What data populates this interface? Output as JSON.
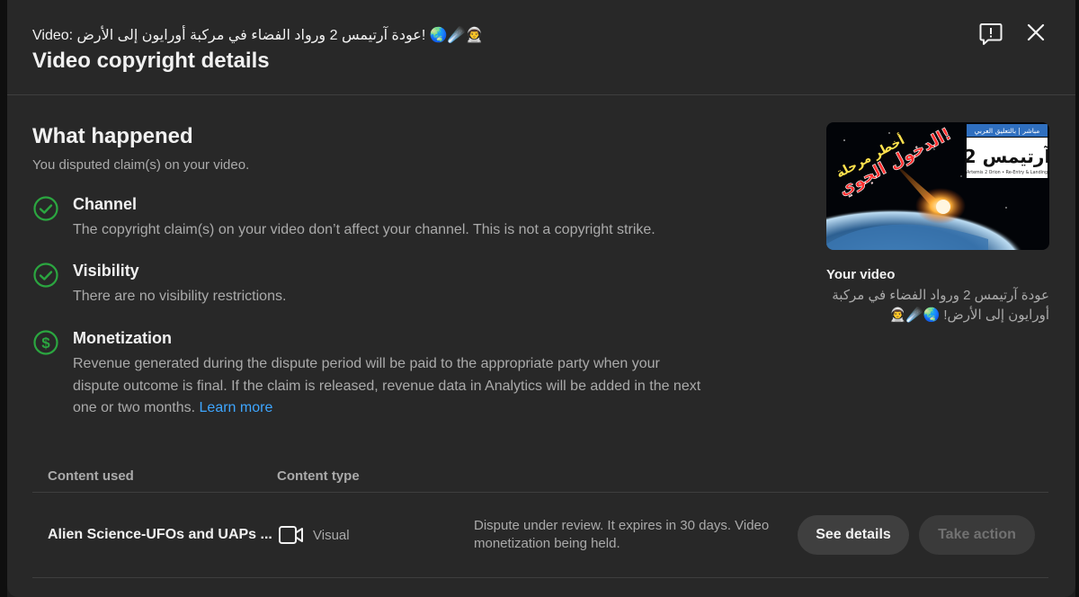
{
  "header": {
    "video_line": "Video: عودة آرتيمس 2 ورواد الفضاء في مركبة أورايون إلى الأرض! 🌏☄️👨‍🚀",
    "title": "Video copyright details"
  },
  "what_happened": {
    "title": "What happened",
    "subtitle": "You disputed claim(s) on your video."
  },
  "items": [
    {
      "title": "Channel",
      "desc": "The copyright claim(s) on your video don’t affect your channel. This is not a copyright strike.",
      "icon": "check-circle-icon"
    },
    {
      "title": "Visibility",
      "desc": "There are no visibility restrictions.",
      "icon": "check-circle-icon"
    },
    {
      "title": "Monetization",
      "desc": "Revenue generated during the dispute period will be paid to the appropriate party when your dispute outcome is final. If the claim is released, revenue data in Analytics will be added in the next one or two months.",
      "link": "Learn more",
      "icon": "dollar-circle-icon"
    }
  ],
  "your_video": {
    "label": "Your video",
    "title": "عودة آرتيمس 2 ورواد الفضاء في مركبة أورايون إلى الأرض! 🌏☄️👨‍🚀",
    "thumbnail": {
      "tag": "مباشر | بالتعليق العربي",
      "title_ar": "آرتيمس 2",
      "subtitle": "Artemis 2 Orion • Re-Entry & Landing",
      "headline_1": "أخطر مرحلة",
      "headline_2": "الدخول الجوي!"
    }
  },
  "table": {
    "headers": [
      "Content used",
      "Content type"
    ],
    "rows": [
      {
        "content": "Alien Science-UFOs and UAPs ...",
        "type": "Visual",
        "status": "Dispute under review. It expires in 30 days. Video monetization being held.",
        "primary_button": "See details",
        "secondary_button": "Take action"
      }
    ]
  },
  "colors": {
    "background": "#282828",
    "success_green": "#2ba640",
    "link_blue": "#3ea6ff"
  }
}
